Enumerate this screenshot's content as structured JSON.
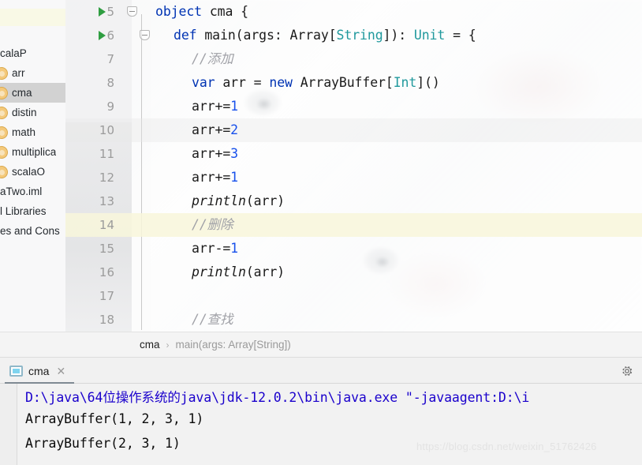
{
  "sidebar": {
    "name": "project-tree",
    "top_label": "calaP",
    "items": [
      {
        "label": "calaP",
        "icon": null,
        "selected": false
      },
      {
        "label": "arr",
        "icon": "scala-object-icon",
        "selected": false
      },
      {
        "label": "cma",
        "icon": "scala-object-icon",
        "selected": true
      },
      {
        "label": "distin",
        "icon": "scala-object-icon",
        "selected": false
      },
      {
        "label": "math",
        "icon": "scala-object-icon",
        "selected": false
      },
      {
        "label": "multiplica",
        "icon": "scala-object-icon",
        "selected": false
      },
      {
        "label": "scalaO",
        "icon": "scala-object-icon",
        "selected": false
      },
      {
        "label": "aTwo.iml",
        "icon": null,
        "selected": false
      },
      {
        "label": "l Libraries",
        "icon": null,
        "selected": false
      },
      {
        "label": "es and Cons",
        "icon": null,
        "selected": false
      }
    ]
  },
  "editor": {
    "name": "scala-code-editor",
    "language": "Scala",
    "lines": [
      {
        "num": "5",
        "indent": 0,
        "text": "object cma {",
        "run_arrow": true,
        "fold": "collapse",
        "highlight": "none"
      },
      {
        "num": "6",
        "indent": 1,
        "text": "def main(args: Array[String]): Unit = {",
        "run_arrow": true,
        "fold": "collapse",
        "highlight": "none"
      },
      {
        "num": "7",
        "indent": 2,
        "text": "//添加",
        "run_arrow": false,
        "fold": null,
        "highlight": "none"
      },
      {
        "num": "8",
        "indent": 2,
        "text": "var arr = new ArrayBuffer[Int]()",
        "run_arrow": false,
        "fold": null,
        "highlight": "none"
      },
      {
        "num": "9",
        "indent": 2,
        "text": "arr+=1",
        "run_arrow": false,
        "fold": null,
        "highlight": "none"
      },
      {
        "num": "10",
        "indent": 2,
        "text": "arr+=2",
        "run_arrow": false,
        "fold": null,
        "highlight": "dim"
      },
      {
        "num": "11",
        "indent": 2,
        "text": "arr+=3",
        "run_arrow": false,
        "fold": null,
        "highlight": "none"
      },
      {
        "num": "12",
        "indent": 2,
        "text": "arr+=1",
        "run_arrow": false,
        "fold": null,
        "highlight": "none"
      },
      {
        "num": "13",
        "indent": 2,
        "text": "println(arr)",
        "run_arrow": false,
        "fold": null,
        "highlight": "none"
      },
      {
        "num": "14",
        "indent": 2,
        "text": "//删除",
        "run_arrow": false,
        "fold": null,
        "highlight": "caret"
      },
      {
        "num": "15",
        "indent": 2,
        "text": "arr-=1",
        "run_arrow": false,
        "fold": null,
        "highlight": "none"
      },
      {
        "num": "16",
        "indent": 2,
        "text": "println(arr)",
        "run_arrow": false,
        "fold": null,
        "highlight": "none"
      },
      {
        "num": "17",
        "indent": 2,
        "text": "",
        "run_arrow": false,
        "fold": null,
        "highlight": "none"
      },
      {
        "num": "18",
        "indent": 2,
        "text": "//查找",
        "run_arrow": false,
        "fold": null,
        "highlight": "none"
      }
    ]
  },
  "breadcrumb": {
    "name": "navigation-breadcrumb",
    "object": "cma",
    "separator": "›",
    "method": "main(args: Array[String])"
  },
  "run_window": {
    "name": "run-tool-window",
    "tab_label": "cma",
    "tab_close": "✕",
    "gear_tooltip": "settings-icon",
    "console_lines": [
      {
        "text": "D:\\java\\64位操作系统的java\\jdk-12.0.2\\bin\\java.exe \"-javaagent:D:\\i",
        "kind": "command"
      },
      {
        "text": "ArrayBuffer(1, 2, 3, 1)",
        "kind": "output"
      },
      {
        "text": "ArrayBuffer(2, 3, 1)",
        "kind": "output"
      }
    ]
  },
  "watermark": {
    "text": "https://blog.csdn.net/weixin_51762426"
  },
  "colors": {
    "keyword": "#0033b3",
    "type": "#20999d",
    "number": "#1750eb",
    "comment": "#a0a1a7",
    "console_command": "#1a00cc",
    "run_arrow": "#2f9e41",
    "selection": "#d2d2d2",
    "caret_row": "#f8f6db"
  }
}
